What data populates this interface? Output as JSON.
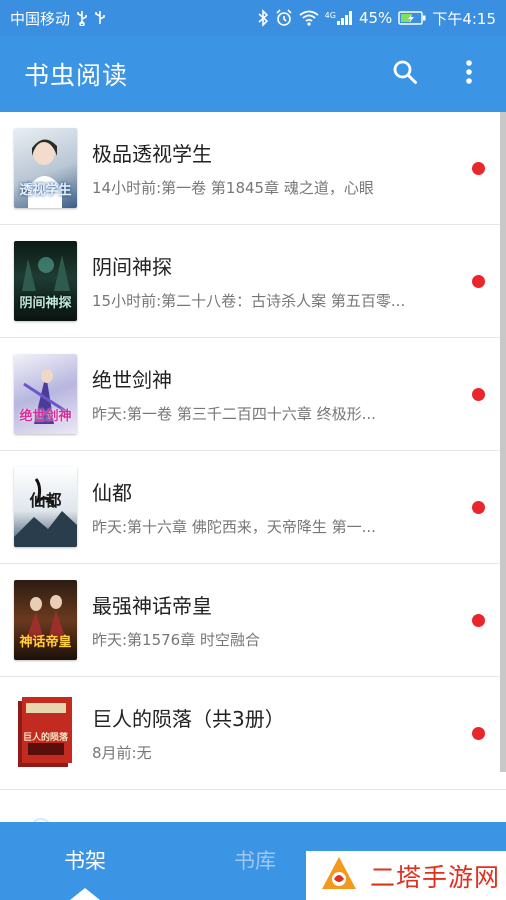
{
  "status_bar": {
    "carrier": "中国移动",
    "network": "4G",
    "battery": "45%",
    "time": "下午4:15"
  },
  "app_bar": {
    "title": "书虫阅读",
    "search_icon": "search-icon",
    "more_icon": "more-vert-icon"
  },
  "colors": {
    "primary": "#3b94e4",
    "new_dot": "#e8262b",
    "watermark": "#e0301e"
  },
  "books": [
    {
      "title": "极品透视学生",
      "latest": "14小时前:第一卷 第1845章 魂之道，心眼",
      "has_update": true,
      "cover_caption": "透视学生"
    },
    {
      "title": "阴间神探",
      "latest": "15小时前:第二十八卷：古诗杀人案 第五百零...",
      "has_update": true,
      "cover_caption": "阴间神探"
    },
    {
      "title": "绝世剑神",
      "latest": "昨天:第一卷 第三千二百四十六章 终极形...",
      "has_update": true,
      "cover_caption": "绝世剑神"
    },
    {
      "title": "仙都",
      "latest": "昨天:第十六章 佛陀西来，天帝降生 第一...",
      "has_update": true,
      "cover_caption": "仙都"
    },
    {
      "title": "最强神话帝皇",
      "latest": "昨天:第1576章 时空融合",
      "has_update": true,
      "cover_caption": "神话帝皇"
    },
    {
      "title": "巨人的陨落（共3册）",
      "latest": "8月前:无",
      "has_update": true,
      "cover_caption": "巨人的陨落"
    }
  ],
  "bottom_nav": {
    "tabs": [
      {
        "label": "书架",
        "active": true
      },
      {
        "label": "书库",
        "active": false
      }
    ]
  },
  "watermark": {
    "text": "二塔手游网"
  }
}
